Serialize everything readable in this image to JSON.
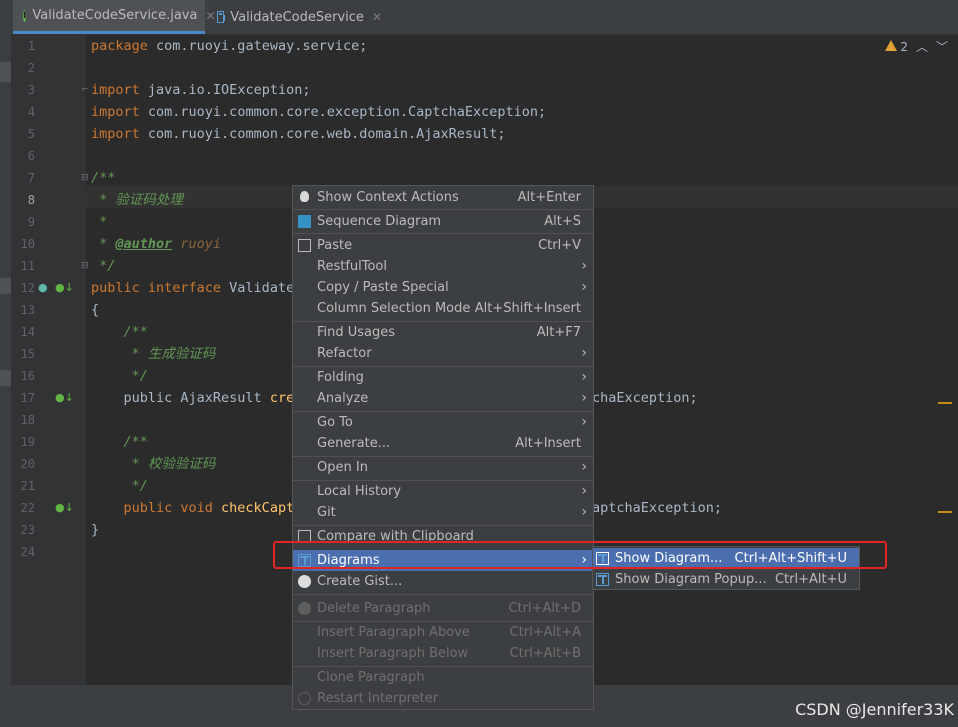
{
  "tabs": [
    {
      "label": "ValidateCodeService.java",
      "icon": "interface-icon",
      "active": true
    },
    {
      "label": "ValidateCodeService",
      "icon": "diagram-icon",
      "active": false
    }
  ],
  "inspection": {
    "warnings": "2"
  },
  "line_numbers": [
    "1",
    "2",
    "3",
    "4",
    "5",
    "6",
    "7",
    "8",
    "9",
    "10",
    "11",
    "12",
    "13",
    "14",
    "15",
    "16",
    "17",
    "18",
    "19",
    "20",
    "21",
    "22",
    "23",
    "24"
  ],
  "code": {
    "l1_kw": "package",
    "l1_rest": " com.ruoyi.gateway.service;",
    "l3_kw": "import",
    "l3_rest": " java.io.IOException;",
    "l4_kw": "import",
    "l4_rest": " com.ruoyi.common.core.exception.CaptchaException;",
    "l5_kw": "import",
    "l5_rest": " com.ruoyi.common.core.web.domain.AjaxResult;",
    "l7": "/**",
    "l8": " * 验证码处理",
    "l9": " *",
    "l10_pre": " * ",
    "l10_tag": "@author",
    "l10_val": " ruoyi",
    "l11": " */",
    "l12_kw": "public interface",
    "l12_rest": " Validate",
    "l13": "{",
    "l14": "    /**",
    "l15": "     * 生成验证码",
    "l16": "     */",
    "l17_pre": "    public AjaxResult ",
    "l17_fn": "cre",
    "l17_tail": "chaException;",
    "l19": "    /**",
    "l20": "     * 校验验证码",
    "l21": "     */",
    "l22_kw1": "    public ",
    "l22_kw2": "void ",
    "l22_fn": "checkCapt",
    "l22_tail": "aptchaException;",
    "l23": "}"
  },
  "context_menu": {
    "items": [
      {
        "label": "Show Context Actions",
        "shortcut": "Alt+Enter",
        "icon": "lightbulb-icon"
      },
      {
        "label": "Sequence Diagram",
        "shortcut": "Alt+S",
        "icon": "sequence-diagram-icon"
      },
      {
        "label": "Paste",
        "shortcut": "Ctrl+V",
        "icon": "clipboard-icon"
      },
      {
        "label": "RestfulTool",
        "submenu": true
      },
      {
        "label": "Copy / Paste Special",
        "submenu": true
      },
      {
        "label": "Column Selection Mode",
        "shortcut": "Alt+Shift+Insert"
      },
      {
        "label": "Find Usages",
        "shortcut": "Alt+F7"
      },
      {
        "label": "Refactor",
        "submenu": true
      },
      {
        "label": "Folding",
        "submenu": true
      },
      {
        "label": "Analyze",
        "submenu": true
      },
      {
        "label": "Go To",
        "submenu": true
      },
      {
        "label": "Generate...",
        "shortcut": "Alt+Insert"
      },
      {
        "label": "Open In",
        "submenu": true
      },
      {
        "label": "Local History",
        "submenu": true
      },
      {
        "label": "Git",
        "submenu": true
      },
      {
        "label": "Compare with Clipboard",
        "icon": "compare-icon"
      },
      {
        "label": "Diagrams",
        "submenu": true,
        "icon": "diagram-icon",
        "highlighted": true
      },
      {
        "label": "Create Gist...",
        "icon": "github-icon"
      },
      {
        "label": "Delete Paragraph",
        "shortcut": "Ctrl+Alt+D",
        "disabled": true
      },
      {
        "label": "Insert Paragraph Above",
        "shortcut": "Ctrl+Alt+A",
        "disabled": true
      },
      {
        "label": "Insert Paragraph Below",
        "shortcut": "Ctrl+Alt+B",
        "disabled": true
      },
      {
        "label": "Clone Paragraph",
        "disabled": true
      },
      {
        "label": "Restart Interpreter",
        "disabled": true
      }
    ]
  },
  "diagrams_submenu": {
    "items": [
      {
        "label": "Show Diagram...",
        "shortcut": "Ctrl+Alt+Shift+U",
        "highlighted": true
      },
      {
        "label": "Show Diagram Popup...",
        "shortcut": "Ctrl+Alt+U"
      }
    ]
  },
  "watermark": "CSDN @Jennifer33K",
  "colors": {
    "menu_highlight": "#4b6eaf",
    "annotation_box": "#e32424",
    "editor_bg": "#2b2b2b"
  }
}
